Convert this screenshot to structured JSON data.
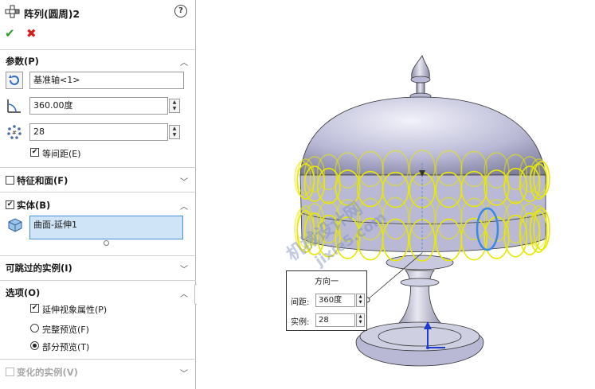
{
  "header": {
    "title": "阵列(圆周)2",
    "help": "?"
  },
  "actions": {
    "ok": "✔",
    "cancel": "✖"
  },
  "params": {
    "title": "参数(P)",
    "axis_value": "基准轴<1>",
    "angle_value": "360.00度",
    "count_value": "28",
    "equal_spacing_label": "等间距(E)",
    "equal_spacing_checked": true
  },
  "features": {
    "title": "特征和面(F)",
    "checked": false
  },
  "bodies": {
    "title": "实体(B)",
    "checked": true,
    "items": [
      "曲面-延伸1"
    ]
  },
  "skip": {
    "title": "可跳过的实例(I)"
  },
  "options": {
    "title": "选项(O)",
    "propagate_label": "延伸视象属性(P)",
    "propagate_checked": true,
    "full_preview_label": "完整预览(F)",
    "partial_preview_label": "部分预览(T)",
    "selected_preview": "partial"
  },
  "vary": {
    "title": "变化的实例(V)"
  },
  "callout": {
    "title": "方向一",
    "spacing_label": "间距:",
    "spacing_value": "360度",
    "instances_label": "实例:",
    "instances_value": "28"
  },
  "watermark": [
    "机械设计网",
    "jixie5.com"
  ],
  "colors": {
    "preview_yellow": "#e8e800",
    "body": "#b9b9d6",
    "highlight": "#3a8be0"
  }
}
